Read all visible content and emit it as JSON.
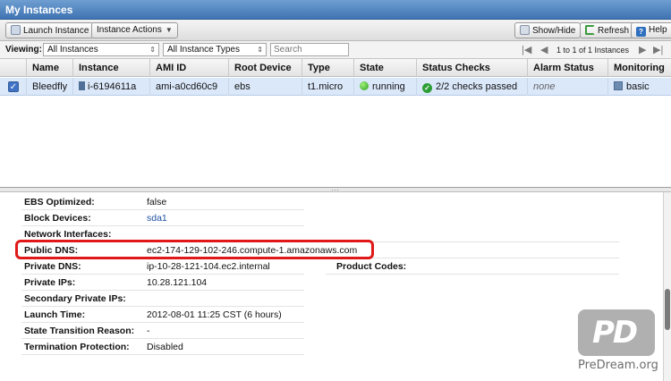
{
  "window": {
    "title": "My Instances"
  },
  "toolbar": {
    "launch_label": "Launch Instance",
    "actions_label": "Instance Actions",
    "showhide_label": "Show/Hide",
    "refresh_label": "Refresh",
    "help_label": "Help"
  },
  "filters": {
    "viewing_label": "Viewing:",
    "instances_value": "All Instances",
    "types_value": "All Instance Types",
    "search_placeholder": "Search",
    "pagination": "1 to 1 of 1 Instances"
  },
  "grid": {
    "columns": [
      "Name",
      "Instance",
      "AMI ID",
      "Root Device",
      "Type",
      "State",
      "Status Checks",
      "Alarm Status",
      "Monitoring"
    ],
    "row": {
      "selected": true,
      "name": "Bleedfly",
      "instance": "i-6194611a",
      "ami": "ami-a0cd60c9",
      "root_device": "ebs",
      "type": "t1.micro",
      "state": "running",
      "status_checks": "2/2 checks passed",
      "alarm_status": "none",
      "monitoring": "basic"
    }
  },
  "details": {
    "ebs_optimized": {
      "label": "EBS Optimized:",
      "value": "false"
    },
    "block_devices": {
      "label": "Block Devices:",
      "value": "sda1"
    },
    "network_interfaces": {
      "label": "Network Interfaces:",
      "value": ""
    },
    "public_dns": {
      "label": "Public DNS:",
      "value": "ec2-174-129-102-246.compute-1.amazonaws.com"
    },
    "private_dns": {
      "label": "Private DNS:",
      "value": "ip-10-28-121-104.ec2.internal"
    },
    "product_codes": {
      "label": "Product Codes:",
      "value": ""
    },
    "private_ips": {
      "label": "Private IPs:",
      "value": "10.28.121.104"
    },
    "secondary_private_ips": {
      "label": "Secondary Private IPs:",
      "value": ""
    },
    "launch_time": {
      "label": "Launch Time:",
      "value": "2012-08-01 11:25 CST (6 hours)"
    },
    "state_transition_reason": {
      "label": "State Transition Reason:",
      "value": "-"
    },
    "termination_protection": {
      "label": "Termination Protection:",
      "value": "Disabled"
    }
  },
  "watermark": {
    "logo_text": "PD",
    "site": "PreDream.org"
  },
  "colors": {
    "title_bar": "#4a7fbe",
    "selected_row": "#dbe8fa",
    "highlight": "#e01818",
    "running": "#2f9e1e"
  }
}
